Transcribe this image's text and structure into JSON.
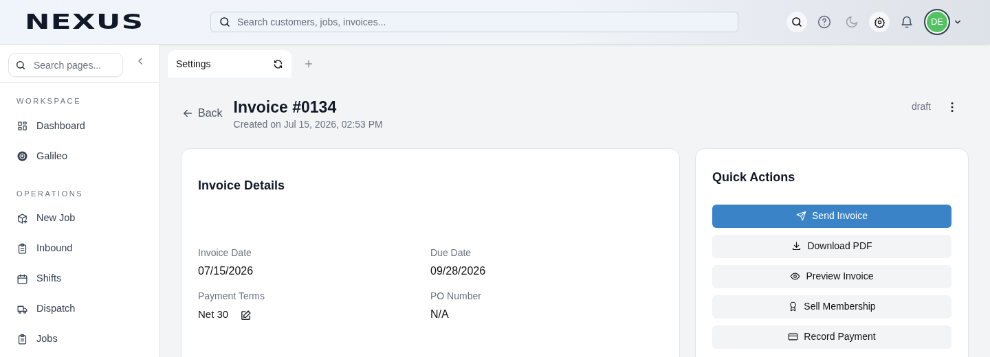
{
  "header": {
    "logo": "NEXUS",
    "search": {
      "placeholder": "Search customers, jobs, invoices..."
    },
    "avatar": "DE"
  },
  "sidebar": {
    "search": {
      "placeholder": "Search pages..."
    },
    "sections": [
      {
        "title": "WORKSPACE",
        "items": [
          {
            "label": "Dashboard"
          },
          {
            "label": "Galileo"
          }
        ]
      },
      {
        "title": "OPERATIONS",
        "items": [
          {
            "label": "New Job"
          },
          {
            "label": "Inbound"
          },
          {
            "label": "Shifts"
          },
          {
            "label": "Dispatch"
          },
          {
            "label": "Jobs"
          }
        ]
      }
    ]
  },
  "tabs": [
    {
      "label": "Settings",
      "selected": true
    }
  ],
  "page": {
    "back": "Back",
    "title": "Invoice #0134",
    "subtitle": "Created on Jul 15, 2026, 02:53 PM",
    "status": "draft"
  },
  "details": {
    "title": "Invoice Details",
    "fields": [
      {
        "label": "Invoice Date",
        "value": "07/15/2026",
        "editable": false
      },
      {
        "label": "Due Date",
        "value": "09/28/2026",
        "editable": false
      },
      {
        "label": "Payment Terms",
        "value": "Net 30",
        "editable": true
      },
      {
        "label": "PO Number",
        "value": "N/A",
        "editable": false
      }
    ]
  },
  "quick_actions": {
    "title": "Quick Actions",
    "buttons": [
      {
        "label": "Send Invoice",
        "kind": "primary"
      },
      {
        "label": "Download PDF",
        "kind": "secondary"
      },
      {
        "label": "Preview Invoice",
        "kind": "secondary"
      },
      {
        "label": "Sell Membership",
        "kind": "secondary"
      },
      {
        "label": "Record Payment",
        "kind": "secondary"
      }
    ]
  }
}
